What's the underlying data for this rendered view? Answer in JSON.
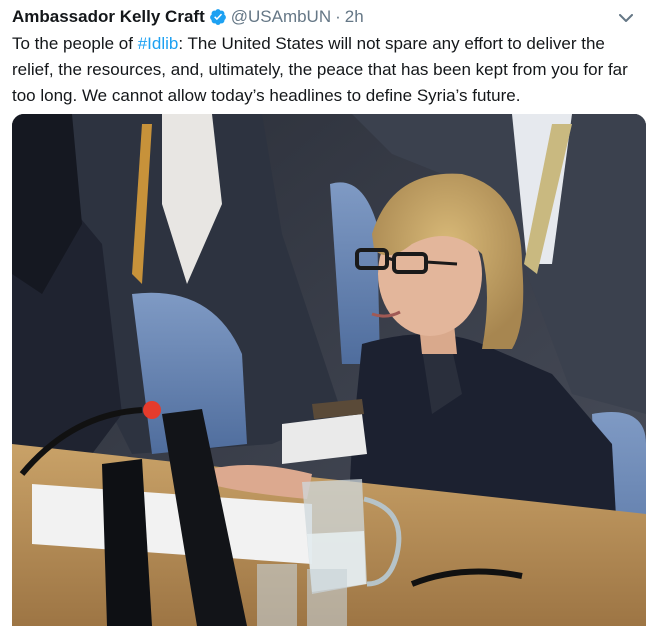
{
  "tweet": {
    "author_name": "Ambassador Kelly Craft",
    "handle": "@USAmbUN",
    "separator": "·",
    "time": "2h",
    "text_before": "To the people of ",
    "hashtag": "#Idlib",
    "text_after": ": The United States will not spare any effort to deliver the relief, the resources, and, ultimately, the peace that has been kept from you for far too long. We cannot allow today’s headlines to define Syria’s future."
  },
  "icons": {
    "verified": "verified-badge-icon",
    "caret": "chevron-down-icon"
  },
  "colors": {
    "link": "#1da1f2",
    "secondary_text": "#657786",
    "primary_text": "#14171a"
  }
}
